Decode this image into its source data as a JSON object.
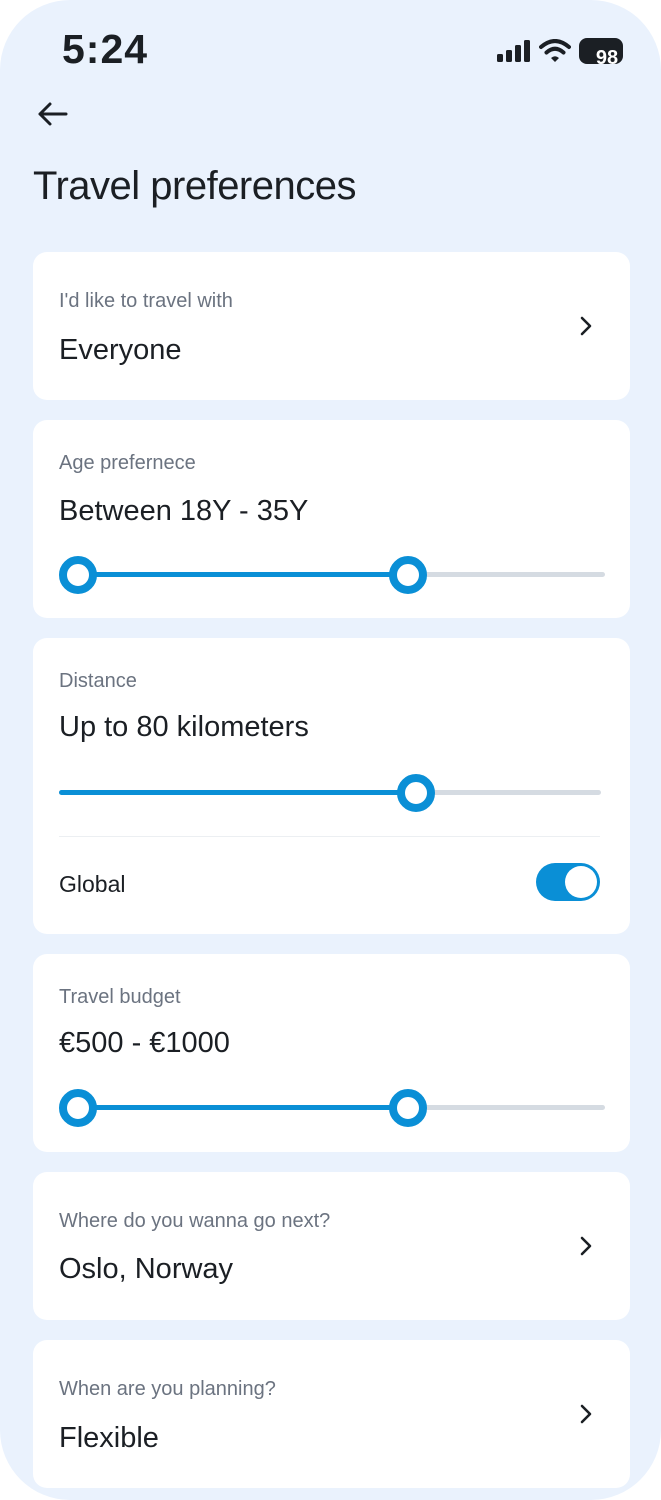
{
  "status_bar": {
    "time": "5:24",
    "battery": "98",
    "icons": [
      "signal-icon",
      "wifi-icon",
      "battery-icon"
    ]
  },
  "header": {
    "back_icon": "arrow-left-icon",
    "title": "Travel preferences"
  },
  "colors": {
    "background": "#eaf2fd",
    "card": "#ffffff",
    "accent": "#0a8fd6",
    "track": "#d5dbe2",
    "label": "#6b7380",
    "text": "#1b1f24"
  },
  "travel_with": {
    "label": "I'd like to travel with",
    "value": "Everyone"
  },
  "age": {
    "label": "Age prefernece",
    "value": "Between 18Y - 35Y",
    "range_low": 0.0,
    "range_high": 0.65
  },
  "distance": {
    "label": "Distance",
    "value": "Up to 80 kilometers",
    "level": 0.67,
    "toggle_label": "Global",
    "toggle_on": true
  },
  "budget": {
    "label": "Travel budget",
    "value": "€500 - €1000",
    "range_low": 0.0,
    "range_high": 0.65
  },
  "destination": {
    "label": "Where do you wanna go next?",
    "value": "Oslo, Norway"
  },
  "planning": {
    "label": "When are you planning?",
    "value": "Flexible"
  }
}
